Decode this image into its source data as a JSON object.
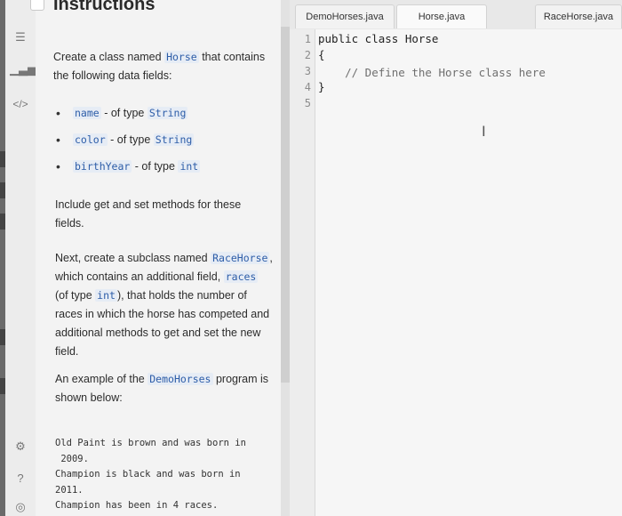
{
  "instructions": {
    "title": "Instructions",
    "intro_a": "Create a class named",
    "intro_class": "Horse",
    "intro_b": "that contains",
    "intro_c": "the following data fields:",
    "fields": [
      {
        "name": "name",
        "sep": "- of type",
        "type": "String"
      },
      {
        "name": "color",
        "sep": "- of type",
        "type": "String"
      },
      {
        "name": "birthYear",
        "sep": "- of type",
        "type": "int"
      }
    ],
    "getset_text": "Include get and set methods for these fields.",
    "subclass_a": "Next, create a subclass named",
    "subclass_name": "RaceHorse",
    "subclass_b": ", which contains an additional field,",
    "subclass_field": "races",
    "subclass_c": "(of type",
    "subclass_type": "int",
    "subclass_d": "), that holds the number of races in which the horse has competed and additional methods to get and set the new field.",
    "example_a": "An example of the",
    "example_prog": "DemoHorses",
    "example_b": "program is shown below:",
    "sample_output": "Old Paint is brown and was born in\n 2009.\nChampion is black and was born in\n2011.\nChampion has been in 4 races."
  },
  "tabs": [
    "DemoHorses.java",
    "Horse.java",
    "RaceHorse.java"
  ],
  "active_tab": "Horse.java",
  "editor": {
    "line_numbers": [
      "1",
      "2",
      "3",
      "4",
      "5"
    ],
    "lines": [
      "public class Horse",
      "{",
      "    // Define the Horse class here",
      "}",
      ""
    ]
  },
  "icons": {
    "rail": [
      "list-icon",
      "chart-icon",
      "code-icon",
      "settings-icon",
      "help-icon",
      "theme-icon"
    ],
    "cursor": "text-cursor-icon"
  }
}
